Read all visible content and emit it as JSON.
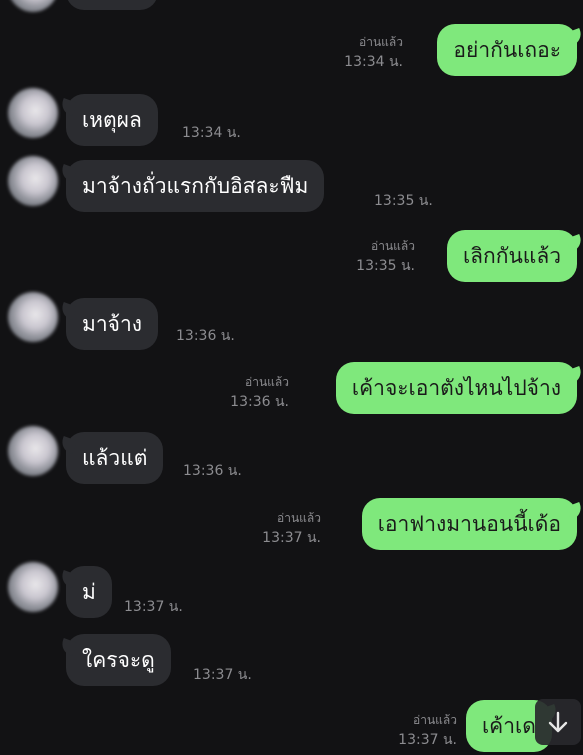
{
  "messages": [
    {
      "side": "out",
      "text": "อย่ากันเถอะ",
      "read": "อ่านแล้ว",
      "time": "13:34 น."
    },
    {
      "side": "in",
      "text": "เหตุผล",
      "time": "13:34 น."
    },
    {
      "side": "in",
      "text": "มาจ้างถั่วแรกกับอิสละฟืม",
      "time": "13:35 น."
    },
    {
      "side": "out",
      "text": "เลิกกันแล้ว",
      "read": "อ่านแล้ว",
      "time": "13:35 น."
    },
    {
      "side": "in",
      "text": "มาจ้าง",
      "time": "13:36 น."
    },
    {
      "side": "out",
      "text": "เค้าจะเอาตังไหนไปจ้าง",
      "read": "อ่านแล้ว",
      "time": "13:36 น."
    },
    {
      "side": "in",
      "text": "แล้วแต่",
      "time": "13:36 น."
    },
    {
      "side": "out",
      "text": "เอาฟางมานอนนี้เด้อ",
      "read": "อ่านแล้ว",
      "time": "13:37 น."
    },
    {
      "side": "in",
      "text": "ม่",
      "time": "13:37 น."
    },
    {
      "side": "in",
      "text": "ใครจะดู",
      "time": "13:37 น."
    },
    {
      "side": "out",
      "text": "เค้าเด",
      "read": "อ่านแล้ว",
      "time": "13:37 น."
    }
  ],
  "icons": {
    "scroll_down": "arrow-down-icon",
    "avatar": "contact-avatar"
  },
  "colors": {
    "background": "#121214",
    "incoming": "#2b2c30",
    "outgoing": "#7fe87c",
    "meta": "#8c8c90"
  }
}
